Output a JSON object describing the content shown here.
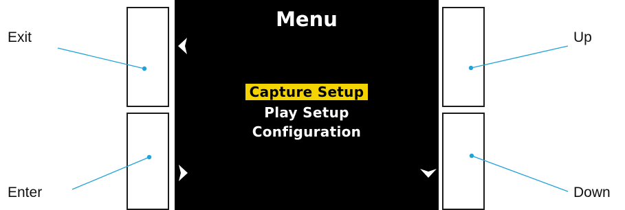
{
  "screen": {
    "title": "Menu",
    "menu_items": [
      {
        "label": "Capture Setup",
        "selected": true
      },
      {
        "label": "Play Setup",
        "selected": false
      },
      {
        "label": "Configuration",
        "selected": false
      }
    ],
    "highlight_color": "#f3d400",
    "background_color": "#000000"
  },
  "buttons": {
    "exit": {
      "label": "Exit",
      "screen_icon": "chevron-left-icon"
    },
    "enter": {
      "label": "Enter",
      "screen_icon": "chevron-right-icon"
    },
    "up": {
      "label": "Up",
      "screen_icon": ""
    },
    "down": {
      "label": "Down",
      "screen_icon": "chevron-down-icon"
    }
  },
  "leader_color": "#1fa3d9"
}
